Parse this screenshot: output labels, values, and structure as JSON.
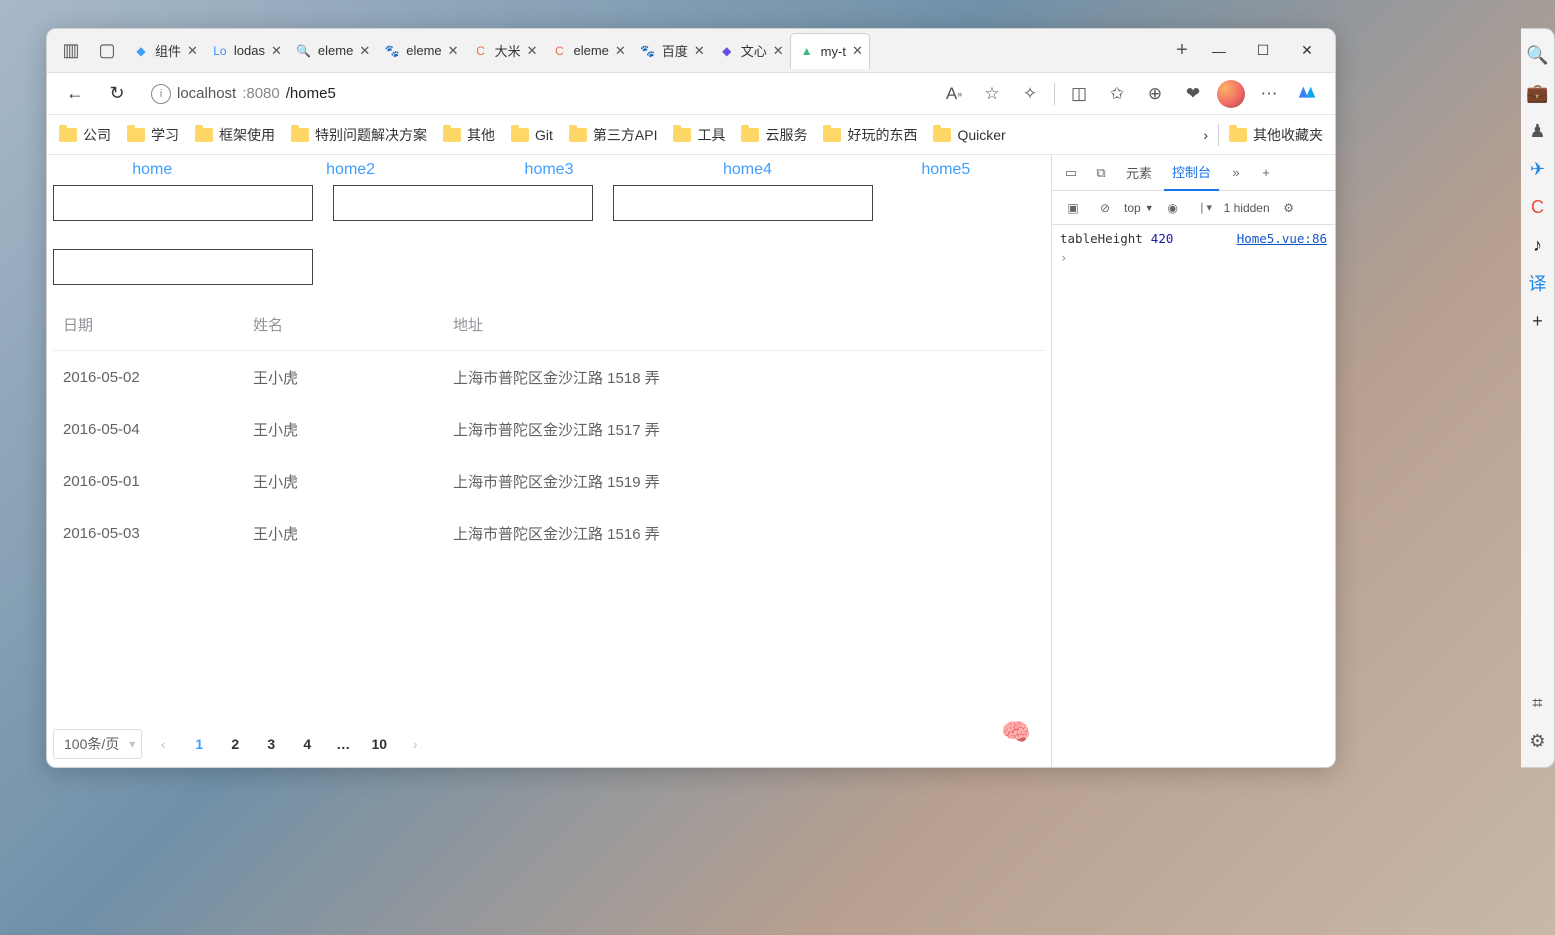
{
  "browser": {
    "tabs": [
      {
        "label": "组件",
        "favicon": "◆",
        "favcolor": "#409eff"
      },
      {
        "label": "lodas",
        "favicon": "Lo",
        "favcolor": "#3492ff"
      },
      {
        "label": "eleme",
        "favicon": "🔍",
        "favcolor": "#4285f4"
      },
      {
        "label": "eleme",
        "favicon": "🐾",
        "favcolor": "#3385ff"
      },
      {
        "label": "大米",
        "favicon": "C",
        "favcolor": "#eb6f4e"
      },
      {
        "label": "eleme",
        "favicon": "C",
        "favcolor": "#eb6f4e"
      },
      {
        "label": "百度",
        "favicon": "🐾",
        "favcolor": "#3385ff"
      },
      {
        "label": "文心",
        "favicon": "◆",
        "favcolor": "#6b4ce6"
      },
      {
        "label": "my-t",
        "favicon": "▲",
        "favcolor": "#41b883",
        "active": true
      }
    ],
    "url": {
      "host": "localhost",
      "port": ":8080",
      "path": "/home5"
    },
    "window_controls": {
      "min": "—",
      "max": "☐",
      "close": "✕"
    }
  },
  "bookmarks": {
    "items": [
      "公司",
      "学习",
      "框架使用",
      "特别问题解决方案",
      "其他",
      "Git",
      "第三方API",
      "工具",
      "云服务",
      "好玩的东西",
      "Quicker"
    ],
    "overflow": "其他收藏夹"
  },
  "page": {
    "nav": [
      "home",
      "home2",
      "home3",
      "home4",
      "home5"
    ],
    "table": {
      "headers": {
        "date": "日期",
        "name": "姓名",
        "addr": "地址"
      },
      "rows": [
        {
          "date": "2016-05-02",
          "name": "王小虎",
          "addr": "上海市普陀区金沙江路 1518 弄"
        },
        {
          "date": "2016-05-04",
          "name": "王小虎",
          "addr": "上海市普陀区金沙江路 1517 弄"
        },
        {
          "date": "2016-05-01",
          "name": "王小虎",
          "addr": "上海市普陀区金沙江路 1519 弄"
        },
        {
          "date": "2016-05-03",
          "name": "王小虎",
          "addr": "上海市普陀区金沙江路 1516 弄"
        }
      ]
    },
    "pagination": {
      "size": "100条/页",
      "pages": [
        "1",
        "2",
        "3",
        "4",
        "…",
        "10"
      ],
      "active": "1"
    }
  },
  "devtools": {
    "tabs": {
      "elements": "元素",
      "console": "控制台"
    },
    "bar": {
      "scope": "top",
      "hidden": "1 hidden"
    },
    "log": {
      "key": "tableHeight",
      "val": "420",
      "src": "Home5.vue:86"
    }
  },
  "sidebar": {
    "items": [
      "🔍",
      "💼",
      "♟",
      "✈",
      "C",
      "♪",
      "译",
      "+"
    ],
    "bottom": [
      "⌗",
      "⚙"
    ]
  }
}
